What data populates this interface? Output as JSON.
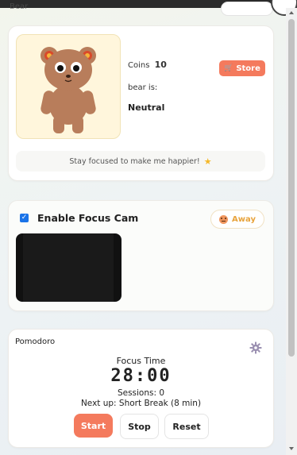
{
  "app": {
    "title": "Bear"
  },
  "bear_card": {
    "coins_label": "Coins",
    "coins_value": "10",
    "store_label": "Store",
    "store_icon": "cart-icon",
    "bear_is_label": "bear is:",
    "mood": "Neutral",
    "motivation": "Stay focused to make me happier!",
    "motivation_icon": "star-icon"
  },
  "focus_cam": {
    "checked": true,
    "label": "Enable Focus Cam",
    "status_label": "Away",
    "status_icon": "sad-face-icon"
  },
  "pomodoro": {
    "title": "Pomodoro",
    "mode_label": "Focus Time",
    "timer": "28:00",
    "sessions": "Sessions: 0",
    "next_up": "Next up: Short Break (8 min)",
    "buttons": {
      "start": "Start",
      "stop": "Stop",
      "reset": "Reset"
    }
  },
  "colors": {
    "accent": "#f47a5d",
    "bear_box_bg": "#fff6dc",
    "checkbox": "#1a73e8",
    "away_text": "#e8a33c"
  }
}
